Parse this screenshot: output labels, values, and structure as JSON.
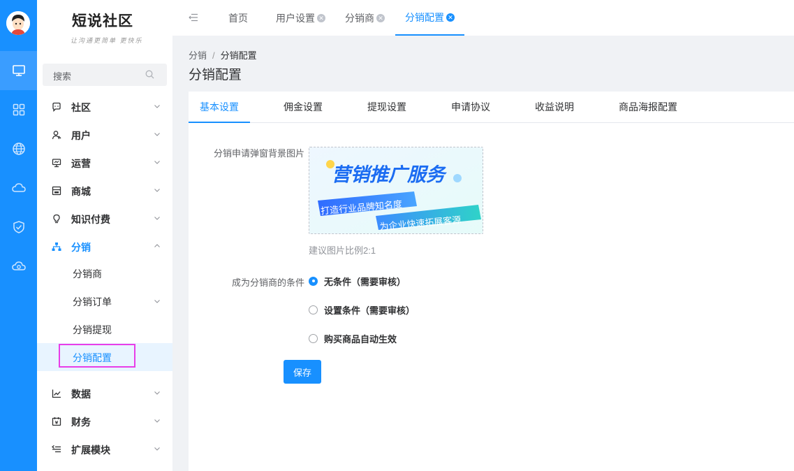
{
  "app": {
    "logo_title": "短说社区",
    "logo_subtitle": "让沟通更简单 更快乐"
  },
  "sidebar": {
    "search_placeholder": "搜索",
    "menu": [
      {
        "label": "社区",
        "icon": "message-icon"
      },
      {
        "label": "用户",
        "icon": "user-icon"
      },
      {
        "label": "运营",
        "icon": "monitor-icon"
      },
      {
        "label": "商城",
        "icon": "shop-icon"
      },
      {
        "label": "知识付费",
        "icon": "lightbulb-icon"
      },
      {
        "label": "分销",
        "icon": "sitemap-icon"
      }
    ],
    "submenu": [
      {
        "label": "分销商"
      },
      {
        "label": "分销订单"
      },
      {
        "label": "分销提现"
      },
      {
        "label": "分销配置"
      }
    ],
    "menu_bottom": [
      {
        "label": "数据",
        "icon": "chart-icon"
      },
      {
        "label": "财务",
        "icon": "calendar-icon"
      },
      {
        "label": "扩展模块",
        "icon": "extension-icon"
      }
    ]
  },
  "topbar": {
    "tabs": [
      {
        "label": "首页"
      },
      {
        "label": "用户设置"
      },
      {
        "label": "分销商"
      },
      {
        "label": "分销配置"
      }
    ]
  },
  "page": {
    "breadcrumb_parent": "分销",
    "breadcrumb_sep": "/",
    "breadcrumb_current": "分销配置",
    "title": "分销配置"
  },
  "content_tabs": [
    {
      "label": "基本设置"
    },
    {
      "label": "佣金设置"
    },
    {
      "label": "提现设置"
    },
    {
      "label": "申请协议"
    },
    {
      "label": "收益说明"
    },
    {
      "label": "商品海报配置"
    }
  ],
  "form": {
    "bg_image_label": "分销申请弹窗背景图片",
    "banner_title": "营销推广服务",
    "banner_line1": "打造行业品牌知名度",
    "banner_line2": "为企业快速拓展客源",
    "hint": "建议图片比例2:1",
    "condition_label": "成为分销商的条件",
    "options": [
      {
        "label": "无条件（需要审核）",
        "checked": true
      },
      {
        "label": "设置条件（需要审核）",
        "checked": false
      },
      {
        "label": "购买商品自动生效",
        "checked": false
      }
    ],
    "save_label": "保存"
  },
  "colors": {
    "primary": "#1890ff",
    "highlight": "#e83ee8"
  }
}
